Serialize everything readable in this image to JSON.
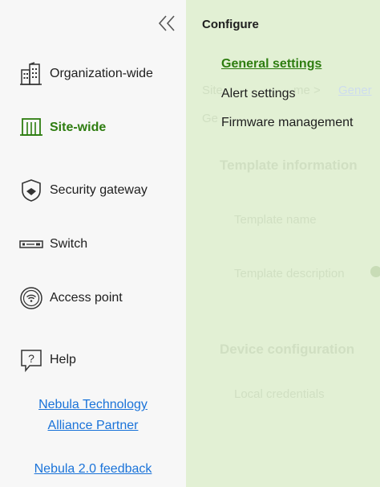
{
  "sidebar": {
    "collapse_icon": "double-chevron-left-icon",
    "items": [
      {
        "label": "Organization-wide",
        "icon": "buildings-icon"
      },
      {
        "label": "Site-wide",
        "icon": "site-gate-icon",
        "active": true
      },
      {
        "label": "Security gateway",
        "icon": "shield-icon"
      },
      {
        "label": "Switch",
        "icon": "switch-device-icon"
      },
      {
        "label": "Access point",
        "icon": "wifi-access-point-icon"
      },
      {
        "label": "Help",
        "icon": "help-bubble-icon"
      }
    ],
    "links": {
      "partner_line1": "Nebula Technology",
      "partner_line2": "Alliance Partner",
      "feedback": "Nebula 2.0 feedback"
    }
  },
  "panel": {
    "title": "Configure",
    "items": [
      {
        "label": "General settings",
        "active": true
      },
      {
        "label": "Alert settings"
      },
      {
        "label": "Firmware management"
      }
    ]
  },
  "background": {
    "breadcrumb": "Site",
    "breadcrumb_suffix": "me >",
    "breadcrumb_link": "Gener",
    "page_title_frag": "Ge",
    "section_template": "Template information",
    "template_name": "Template name",
    "template_description": "Template description",
    "section_device": "Device configuration",
    "local_credentials": "Local credentials"
  },
  "colors": {
    "active_green": "#2e7d10",
    "link_blue": "#1a73d9",
    "panel_bg": "#e2f0d4",
    "sidebar_bg": "#f7f7f7"
  }
}
